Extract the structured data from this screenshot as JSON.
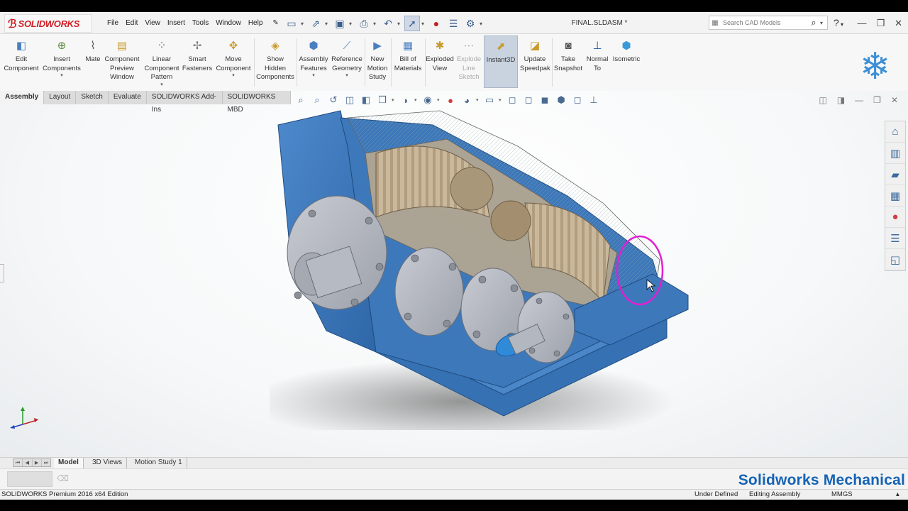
{
  "app": {
    "logo_text": "SOLIDWORKS",
    "document_title": "FINAL.SLDASM *"
  },
  "menu": [
    "File",
    "Edit",
    "View",
    "Insert",
    "Tools",
    "Window",
    "Help"
  ],
  "search": {
    "placeholder": "Search CAD Models"
  },
  "commands": [
    {
      "label": "Edit Component",
      "icon": "edit-component-icon"
    },
    {
      "label": "Insert Components",
      "icon": "insert-components-icon"
    },
    {
      "label": "Mate",
      "icon": "mate-icon"
    },
    {
      "label": "Component Preview Window",
      "icon": "preview-window-icon"
    },
    {
      "label": "Linear Component Pattern",
      "icon": "linear-pattern-icon"
    },
    {
      "label": "Smart Fasteners",
      "icon": "smart-fasteners-icon"
    },
    {
      "label": "Move Component",
      "icon": "move-component-icon"
    },
    {
      "label": "Show Hidden Components",
      "icon": "show-hidden-icon"
    },
    {
      "label": "Assembly Features",
      "icon": "assembly-features-icon"
    },
    {
      "label": "Reference Geometry",
      "icon": "reference-geometry-icon"
    },
    {
      "label": "New Motion Study",
      "icon": "motion-study-icon"
    },
    {
      "label": "Bill of Materials",
      "icon": "bom-icon"
    },
    {
      "label": "Exploded View",
      "icon": "exploded-view-icon"
    },
    {
      "label": "Explode Line Sketch",
      "icon": "explode-line-icon"
    },
    {
      "label": "Instant3D",
      "icon": "instant3d-icon"
    },
    {
      "label": "Update Speedpak",
      "icon": "speedpak-icon"
    },
    {
      "label": "Take Snapshot",
      "icon": "camera-icon"
    },
    {
      "label": "Normal To",
      "icon": "normal-to-icon"
    },
    {
      "label": "Isometric",
      "icon": "isometric-icon"
    }
  ],
  "tabs": [
    "Assembly",
    "Layout",
    "Sketch",
    "Evaluate",
    "SOLIDWORKS Add-Ins",
    "SOLIDWORKS MBD"
  ],
  "bottom_tabs": [
    "Model",
    "3D Views",
    "Motion Study 1"
  ],
  "watermark": "Solidworks Mechanical",
  "status": {
    "edition": "SOLIDWORKS Premium 2016 x64 Edition",
    "definition": "Under Defined",
    "mode": "Editing Assembly",
    "units": "MMGS"
  },
  "colors": {
    "housing_blue": "#3f7cc0",
    "flange_gray": "#b9bcc4",
    "gear_tan": "#c8b79c",
    "selection_magenta": "#e020d0",
    "watermark_blue": "#1463b5"
  }
}
